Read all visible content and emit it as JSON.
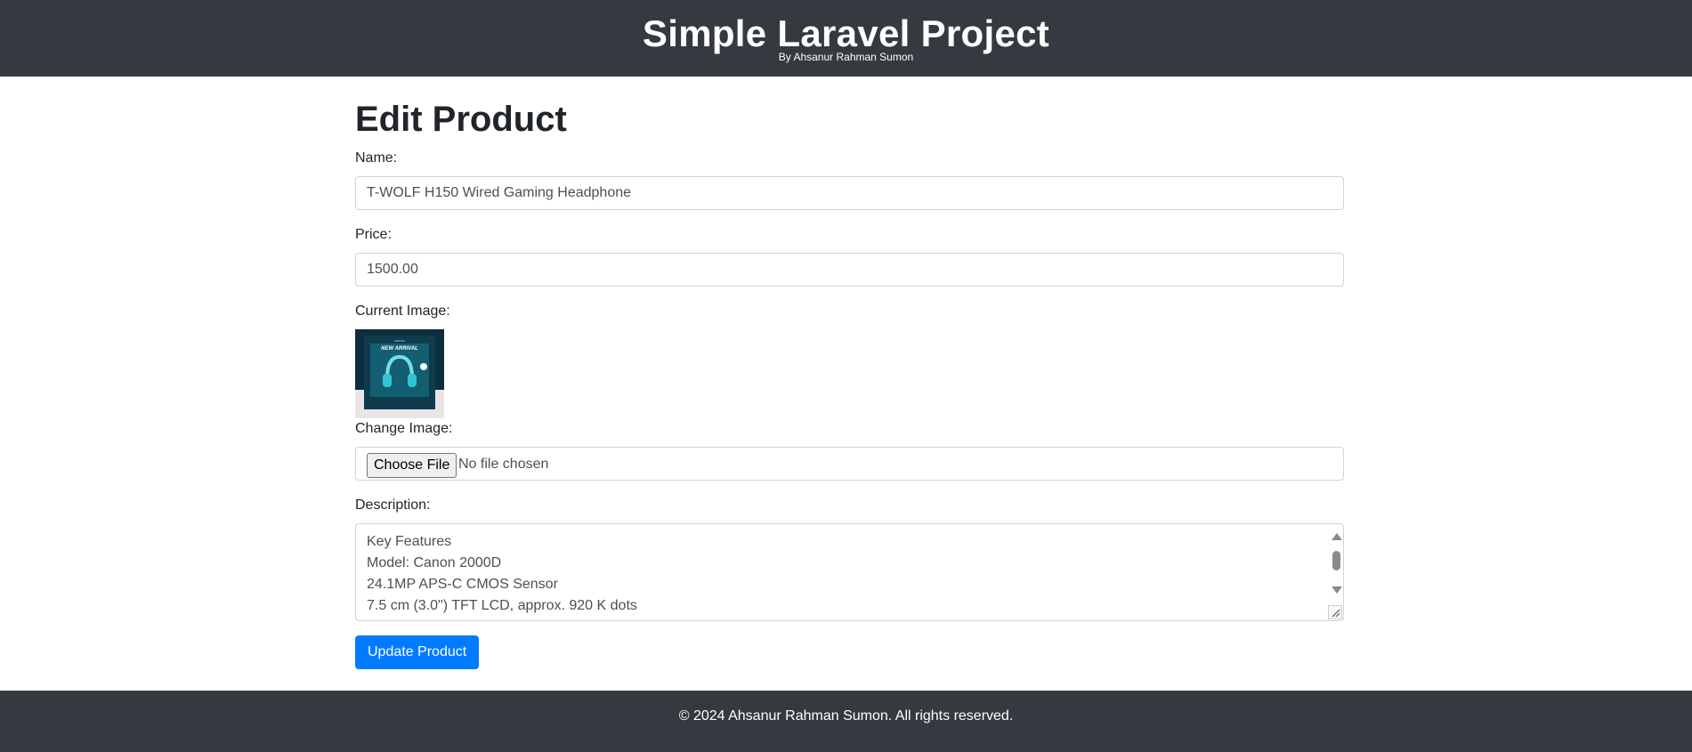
{
  "header": {
    "title": "Simple Laravel Project",
    "subtitle": "By Ahsanur Rahman Sumon",
    "background_color": "#343a40"
  },
  "page": {
    "title": "Edit Product"
  },
  "form": {
    "name_label": "Name:",
    "name_value": "T-WOLF H150 Wired Gaming Headphone",
    "price_label": "Price:",
    "price_value": "1500.00",
    "current_image_label": "Current Image:",
    "current_image": {
      "icon": "headphone-product-image",
      "badge_text": "NEW ARRIVAL"
    },
    "change_image_label": "Change Image:",
    "file_button_label": "Choose File",
    "file_status": "No file chosen",
    "description_label": "Description:",
    "description_lines": [
      "Key Features",
      "Model: Canon 2000D",
      "24.1MP APS-C CMOS Sensor",
      "7.5 cm (3.0\") TFT LCD, approx. 920 K dots"
    ],
    "submit_label": "Update Product",
    "submit_color": "#007bff"
  },
  "footer": {
    "text": "© 2024 Ahsanur Rahman Sumon. All rights reserved.",
    "background_color": "#343a40"
  }
}
